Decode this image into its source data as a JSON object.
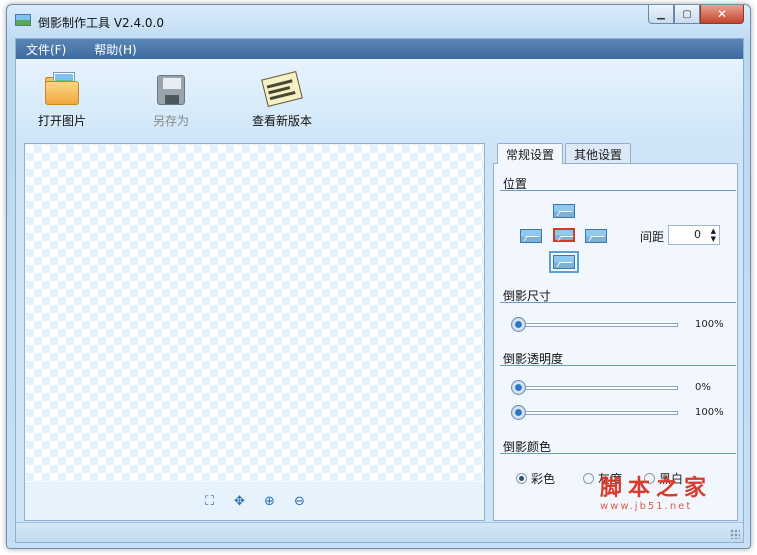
{
  "window": {
    "title": "倒影制作工具 V2.4.0.0"
  },
  "menu": [
    {
      "label": "文件(F)"
    },
    {
      "label": "帮助(H)"
    }
  ],
  "toolbar": {
    "open_label": "打开图片",
    "save_as_label": "另存为",
    "check_version_label": "查看新版本"
  },
  "tabs": [
    {
      "label": "常规设置",
      "active": true
    },
    {
      "label": "其他设置",
      "active": false
    }
  ],
  "settings": {
    "position": {
      "title": "位置",
      "spacing_label": "间距",
      "spacing_value": "0",
      "selected": "center"
    },
    "size": {
      "title": "倒影尺寸",
      "value_label": "100%",
      "value": 0.0
    },
    "opacity": {
      "title": "倒影透明度",
      "start_label": "0%",
      "start_value": 0.0,
      "end_label": "100%",
      "end_value": 0.0
    },
    "color": {
      "title": "倒影颜色",
      "options": [
        {
          "label": "彩色",
          "checked": true
        },
        {
          "label": "灰度",
          "checked": false
        },
        {
          "label": "黑白",
          "checked": false
        }
      ]
    }
  },
  "zoom_icons": [
    "fit-window-icon",
    "actual-size-icon",
    "zoom-in-icon",
    "zoom-out-icon"
  ],
  "watermark": {
    "main": "脚本之家",
    "sub": "www.jb51.net"
  },
  "colors": {
    "accent": "#3e6b9e",
    "close": "#c5432a",
    "watermark": "#d93a2b"
  }
}
